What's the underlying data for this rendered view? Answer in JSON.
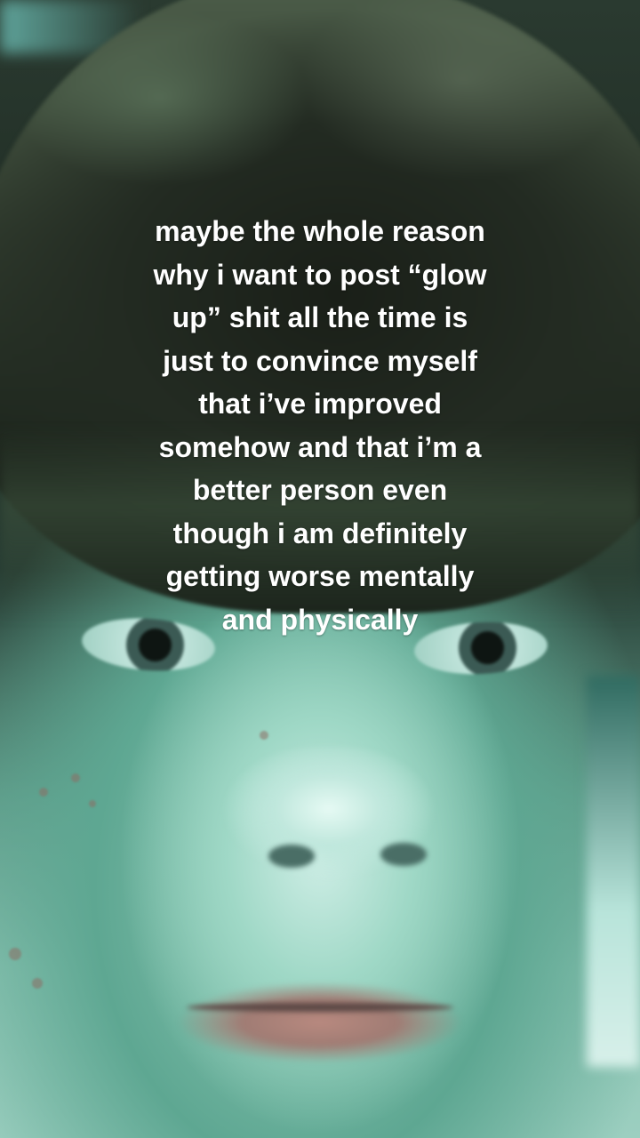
{
  "caption": {
    "lines": [
      "maybe the whole reason",
      "why i want to post “glow",
      "up” shit all the time is",
      "just to convince myself",
      "that i’ve improved",
      "somehow and that i’m a",
      "better person even",
      "though i am definitely",
      "getting worse mentally",
      "and physically"
    ],
    "color": "#ffffff"
  }
}
